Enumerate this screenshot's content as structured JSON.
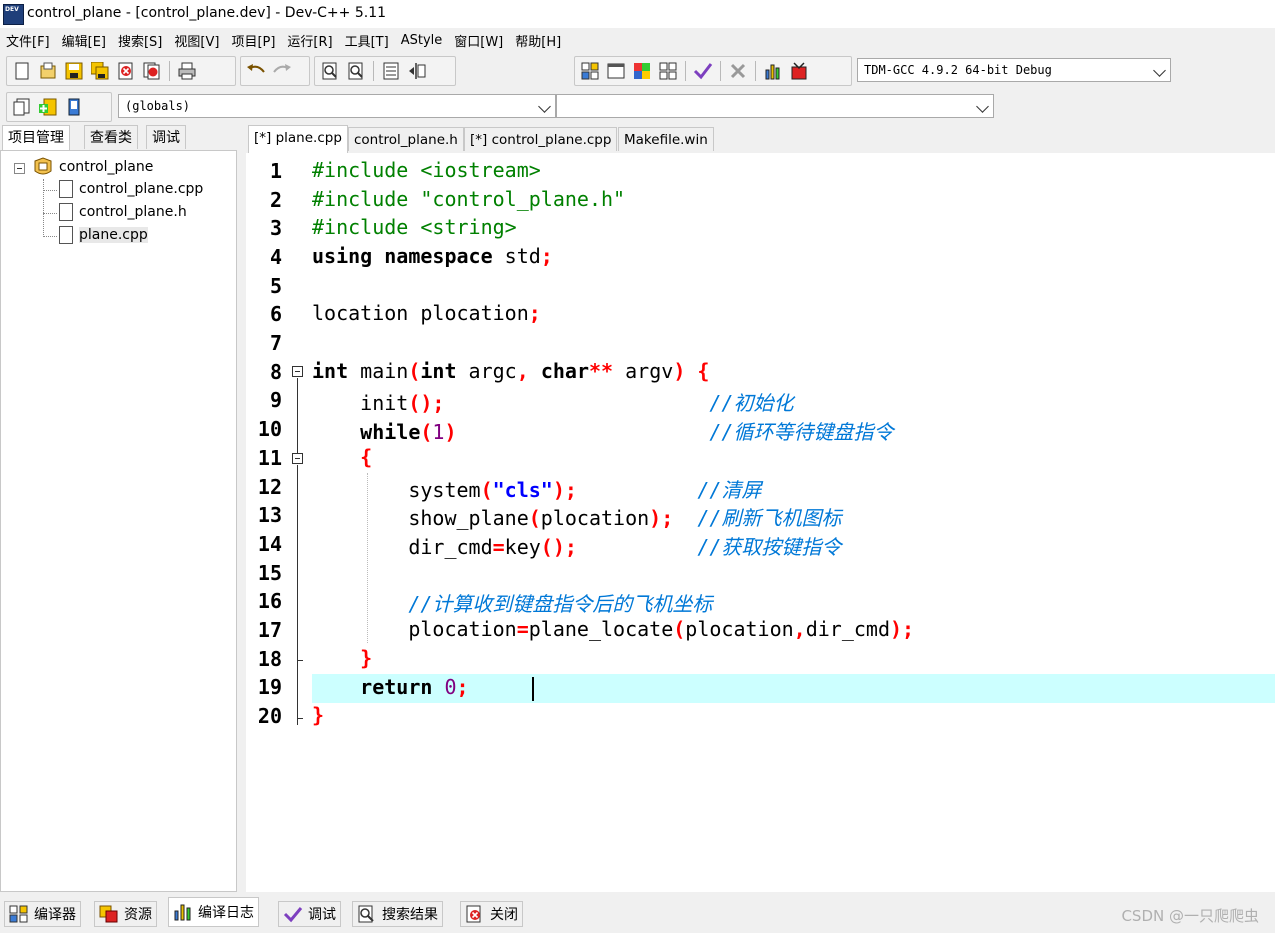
{
  "window": {
    "title": "control_plane - [control_plane.dev] - Dev-C++ 5.11"
  },
  "menu": [
    {
      "label": "文件[F]"
    },
    {
      "label": "编辑[E]"
    },
    {
      "label": "搜索[S]"
    },
    {
      "label": "视图[V]"
    },
    {
      "label": "项目[P]"
    },
    {
      "label": "运行[R]"
    },
    {
      "label": "工具[T]"
    },
    {
      "label": "AStyle"
    },
    {
      "label": "窗口[W]"
    },
    {
      "label": "帮助[H]"
    }
  ],
  "toolbar": {
    "compiler_select": "TDM-GCC 4.9.2 64-bit Debug",
    "scope_select": "(globals)",
    "member_select": ""
  },
  "left_panel": {
    "tabs": [
      "项目管理",
      "查看类",
      "调试"
    ],
    "project": "control_plane",
    "files": [
      "control_plane.cpp",
      "control_plane.h",
      "plane.cpp"
    ]
  },
  "editor_tabs": [
    "[*] plane.cpp",
    "control_plane.h",
    "[*] control_plane.cpp",
    "Makefile.win"
  ],
  "line_numbers": [
    "1",
    "2",
    "3",
    "4",
    "5",
    "6",
    "7",
    "8",
    "9",
    "10",
    "11",
    "12",
    "13",
    "14",
    "15",
    "16",
    "17",
    "18",
    "19",
    "20"
  ],
  "code": {
    "l1": "#include <iostream>",
    "l2": "#include \"control_plane.h\"",
    "l3": "#include <string>",
    "l4_a": "using namespace",
    "l4_b": " std",
    "l4_c": ";",
    "l6_a": "location plocation",
    "l6_b": ";",
    "l8_a": "int",
    "l8_b": " main",
    "l8_c": "(",
    "l8_d": "int",
    "l8_e": " argc",
    "l8_f": ",",
    "l8_g": " char",
    "l8_h": "**",
    "l8_i": " argv",
    "l8_j": ")",
    "l8_k": " {",
    "l9_a": "    init",
    "l9_b": "();",
    "l9_c": "                      ",
    "l9_d": "//初始化",
    "l10_a": "    while",
    "l10_b": "(",
    "l10_c": "1",
    "l10_d": ")",
    "l10_e": "                     ",
    "l10_f": "//循环等待键盘指令",
    "l11_a": "    {",
    "l12_a": "        system",
    "l12_b": "(",
    "l12_c": "\"cls\"",
    "l12_d": ");",
    "l12_e": "          ",
    "l12_f": "//清屏",
    "l13_a": "        show_plane",
    "l13_b": "(",
    "l13_c": "plocation",
    "l13_d": ");",
    "l13_e": "  ",
    "l13_f": "//刷新飞机图标",
    "l14_a": "        dir_cmd",
    "l14_b": "=",
    "l14_c": "key",
    "l14_d": "();",
    "l14_e": "          ",
    "l14_f": "//获取按键指令",
    "l16_a": "        //计算收到键盘指令后的飞机坐标",
    "l17_a": "        plocation",
    "l17_b": "=",
    "l17_c": "plane_locate",
    "l17_d": "(",
    "l17_e": "plocation",
    "l17_f": ",",
    "l17_g": "dir_cmd",
    "l17_h": ");",
    "l18_a": "    }",
    "l19_a": "    return",
    "l19_b": " 0",
    "l19_c": ";",
    "l20_a": "}"
  },
  "bottom_tabs": [
    "编译器",
    "资源",
    "编译日志",
    "调试",
    "搜索结果",
    "关闭"
  ],
  "watermark": "CSDN @一只爬爬虫"
}
